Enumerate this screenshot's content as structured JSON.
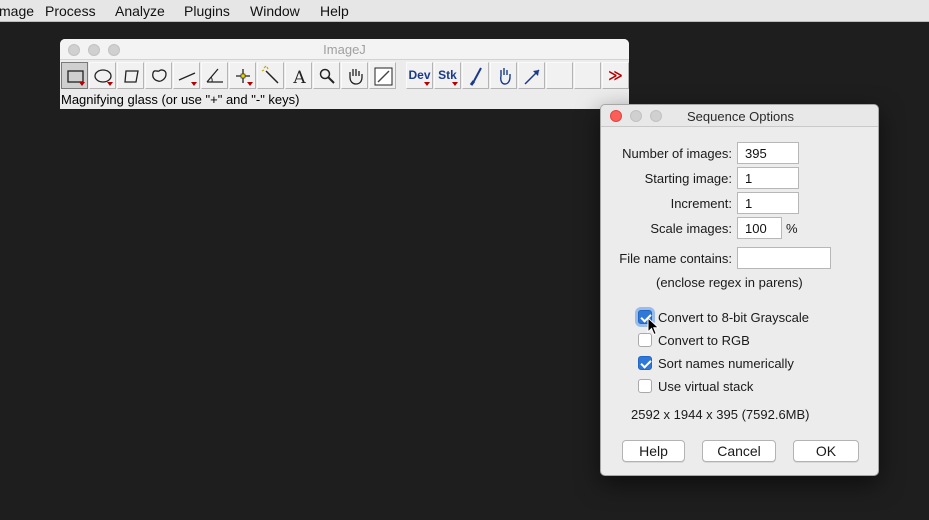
{
  "menubar": {
    "items": [
      "mage",
      "Process",
      "Analyze",
      "Plugins",
      "Window",
      "Help"
    ]
  },
  "imagej": {
    "title": "ImageJ",
    "status": "Magnifying glass (or use \"+\" and \"-\" keys)",
    "tools": {
      "dev_label": "Dev",
      "stk_label": "Stk",
      "text_tool_glyph": "A",
      "more_glyph": "≫"
    }
  },
  "dialog": {
    "title": "Sequence Options",
    "fields": {
      "num_images_label": "Number of images:",
      "num_images_value": "395",
      "start_label": "Starting image:",
      "start_value": "1",
      "increment_label": "Increment:",
      "increment_value": "1",
      "scale_label": "Scale images:",
      "scale_value": "100",
      "scale_unit": "%",
      "filename_label": "File name contains:",
      "filename_value": "",
      "regex_hint": "(enclose regex in parens)"
    },
    "options": [
      {
        "label": "Convert to 8-bit Grayscale",
        "checked": true
      },
      {
        "label": "Convert to RGB",
        "checked": false
      },
      {
        "label": "Sort names numerically",
        "checked": true
      },
      {
        "label": "Use virtual stack",
        "checked": false
      }
    ],
    "info": "2592 x 1944 x 395 (7592.6MB)",
    "buttons": {
      "help": "Help",
      "cancel": "Cancel",
      "ok": "OK"
    }
  },
  "colors": {
    "desktop": "#1e1e1e",
    "checkbox_accent": "#2f78d7",
    "close_light": "#fc5f57"
  }
}
